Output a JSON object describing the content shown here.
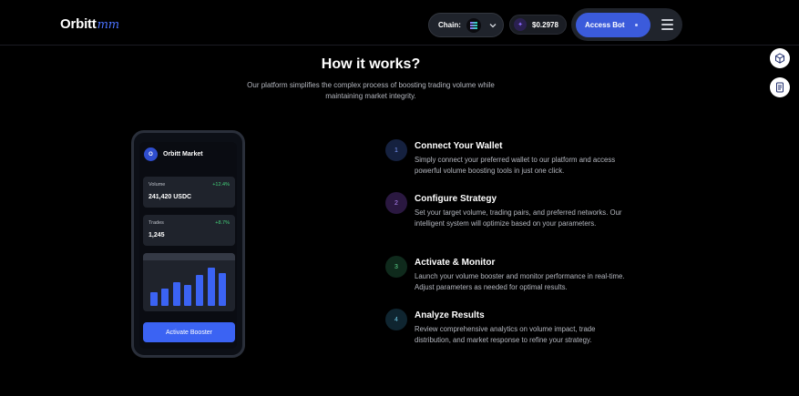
{
  "header": {
    "logo_text": "Orbitt",
    "logo_script": "mm",
    "chain_label": "Chain:",
    "chain_icon": "solana-icon",
    "price": "$0.2978",
    "access_label": "Access Bot"
  },
  "hero": {
    "title": "How it works?",
    "subtitle": "Our platform simplifies the complex process of boosting trading volume while maintaining market integrity."
  },
  "phone": {
    "logo_letter": "O",
    "app_title": "Orbitt Market",
    "volume": {
      "label": "Volume",
      "change": "+12.4%",
      "value": "241,420 USDC"
    },
    "trades": {
      "label": "Trades",
      "change": "+8.7%",
      "value": "1,245"
    },
    "chart_bars": [
      0.28,
      0.36,
      0.5,
      0.44,
      0.66,
      0.8,
      0.7
    ],
    "button_label": "Activate Booster"
  },
  "steps": [
    {
      "num": "1",
      "title": "Connect Your Wallet",
      "desc": "Simply connect your preferred wallet to our platform and access powerful volume boosting tools in just one click.",
      "color": "#15213f",
      "text_color": "#7f9cff"
    },
    {
      "num": "2",
      "title": "Configure Strategy",
      "desc": "Set your target volume, trading pairs, and preferred networks. Our intelligent system will optimize based on your parameters.",
      "color": "#2a1840",
      "text_color": "#b98cff"
    },
    {
      "num": "3",
      "title": "Activate & Monitor",
      "desc": "Launch your volume booster and monitor performance in real-time. Adjust parameters as needed for optimal results.",
      "color": "#0f2a1c",
      "text_color": "#5fd68e"
    },
    {
      "num": "4",
      "title": "Analyze Results",
      "desc": "Review comprehensive analytics on volume impact, trade distribution, and market response to refine your strategy.",
      "color": "#0f2530",
      "text_color": "#6cc4e0"
    }
  ],
  "colors": {
    "accent": "#3b5bdb",
    "positive": "#43d17a"
  }
}
